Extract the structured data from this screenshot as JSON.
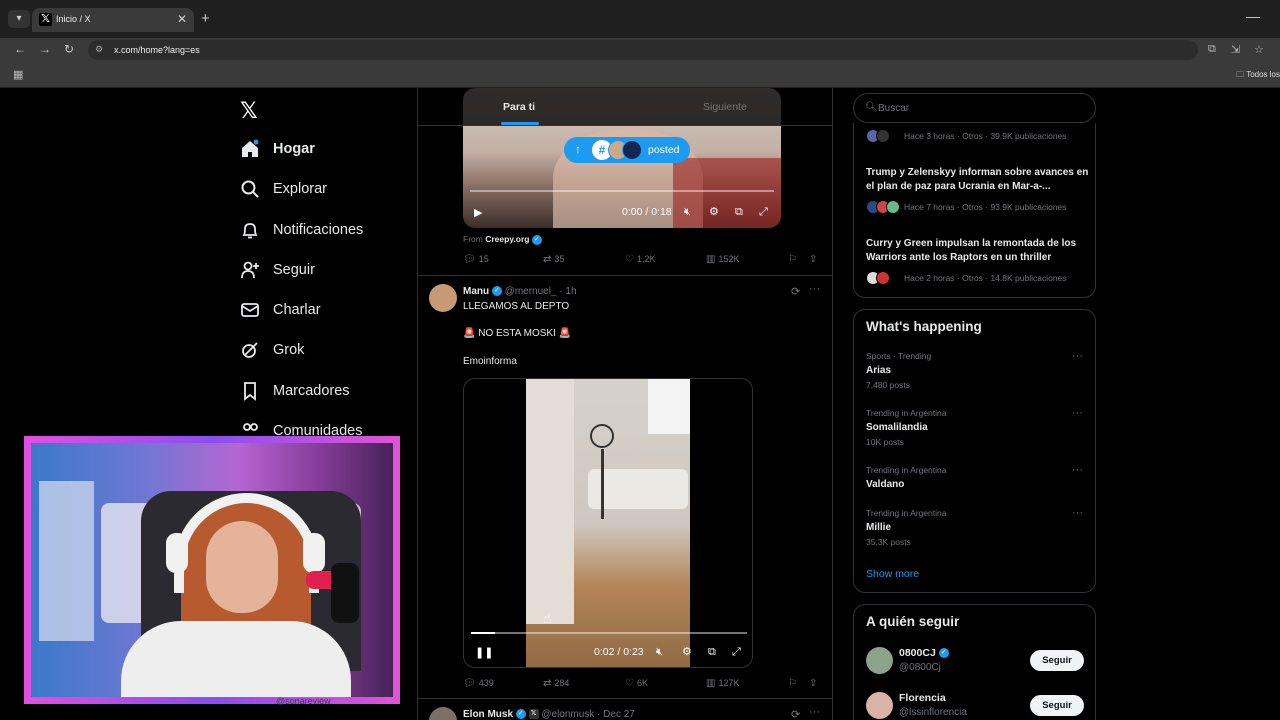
{
  "browser": {
    "tab_title": "Inicio / X",
    "url": "x.com/home?lang=es",
    "bookmarks_folder": "Todos los"
  },
  "nav": {
    "items": [
      {
        "label": "Hogar",
        "icon": "home-icon"
      },
      {
        "label": "Explorar",
        "icon": "search-icon"
      },
      {
        "label": "Notificaciones",
        "icon": "bell-icon"
      },
      {
        "label": "Seguir",
        "icon": "add-user-icon"
      },
      {
        "label": "Charlar",
        "icon": "mail-icon"
      },
      {
        "label": "Grok",
        "icon": "grok-icon"
      },
      {
        "label": "Marcadores",
        "icon": "bookmark-icon"
      },
      {
        "label": "Comunidades",
        "icon": "people-icon"
      }
    ]
  },
  "feed": {
    "tabs": [
      "Para ti",
      "Siguiente"
    ],
    "post1": {
      "pill_text": "posted",
      "video_time": "0:00 / 0:18",
      "from_label": "From",
      "from_source": "Creepy.org",
      "replies": "15",
      "reposts": "35",
      "likes": "1.2K",
      "views": "152K"
    },
    "post2": {
      "name": "Manu",
      "handle": "@mernuel_ · 1h",
      "line1": "LLEGAMOS AL DEPTO",
      "line2": "🚨 NO ESTA MOSKI 🚨",
      "line3": "Emoinforma",
      "video_time": "0:02 / 0:23",
      "video_progress": 0.087,
      "replies": "439",
      "reposts": "284",
      "likes": "6K",
      "views": "127K"
    },
    "post3": {
      "name": "Elon Musk",
      "handle": "@elonmusk · Dec 27"
    }
  },
  "sidebar": {
    "search_placeholder": "Buscar",
    "news": [
      {
        "title": "",
        "meta": "Hace 3 horas · Otros · 39.9K publicaciones"
      },
      {
        "title": "Trump y Zelenskyy informan sobre avances en el plan de paz para Ucrania en Mar-a-...",
        "meta": "Hace 7 horas · Otros · 93.9K publicaciones"
      },
      {
        "title": "Curry y Green impulsan la remontada de los Warriors ante los Raptors en un thriller",
        "meta": "Hace 2 horas · Otros · 14.8K publicaciones"
      }
    ],
    "happening_title": "What's happening",
    "trends": [
      {
        "context": "Sports · Trending",
        "name": "Arias",
        "count": "7,480 posts"
      },
      {
        "context": "Trending in Argentina",
        "name": "Somalilandia",
        "count": "10K posts"
      },
      {
        "context": "Trending in Argentina",
        "name": "Valdano",
        "count": ""
      },
      {
        "context": "Trending in Argentina",
        "name": "Millie",
        "count": "35.3K posts"
      }
    ],
    "show_more": "Show more",
    "who_to_follow_title": "A quién seguir",
    "who_to_follow": [
      {
        "name": "0800CJ",
        "handle": "@0800Cj",
        "button": "Seguir"
      },
      {
        "name": "Florencia",
        "handle": "@lssinflorencia",
        "button": "Seguir"
      }
    ]
  },
  "ghost_handle": "@sonareview"
}
